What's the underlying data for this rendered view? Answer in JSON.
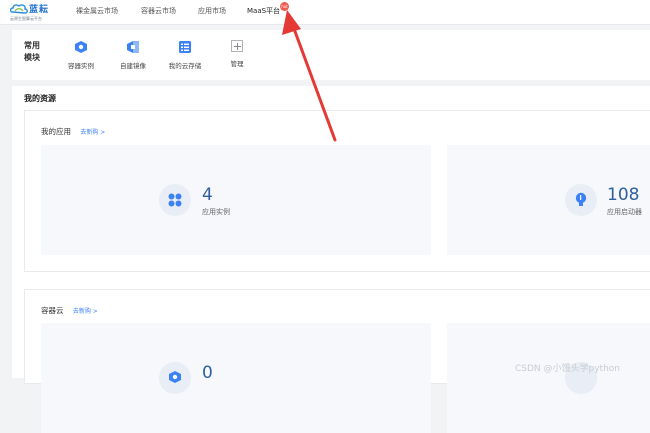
{
  "nav": {
    "logo_name": "蓝耘",
    "logo_sub": "云原生智算云平台",
    "items": [
      "裸金属云市场",
      "容器云市场",
      "应用市场",
      "MaaS平台"
    ],
    "hot_badge": "hot"
  },
  "quick": {
    "title": "常用模块",
    "items": [
      {
        "label": "容器实例",
        "icon": "cube-icon"
      },
      {
        "label": "自建镜像",
        "icon": "image-icon"
      },
      {
        "label": "我的云存储",
        "icon": "storage-icon"
      },
      {
        "label": "管理",
        "icon": "plus-icon"
      }
    ]
  },
  "resources": {
    "title": "我的资源",
    "apps": {
      "title": "我的应用",
      "link": "去新购  >",
      "stats": [
        {
          "value": "4",
          "label": "应用实例"
        },
        {
          "value": "108",
          "label": "应用启动器"
        }
      ]
    },
    "container": {
      "title": "容器云",
      "link": "去新购  >",
      "stats": [
        {
          "value": "0",
          "label": ""
        },
        {
          "value": "",
          "label": ""
        }
      ]
    }
  },
  "watermark": "CSDN @小馒头学python",
  "colors": {
    "accent": "#3b82f6",
    "arrow": "#e53935",
    "number": "#2f5f9e"
  }
}
